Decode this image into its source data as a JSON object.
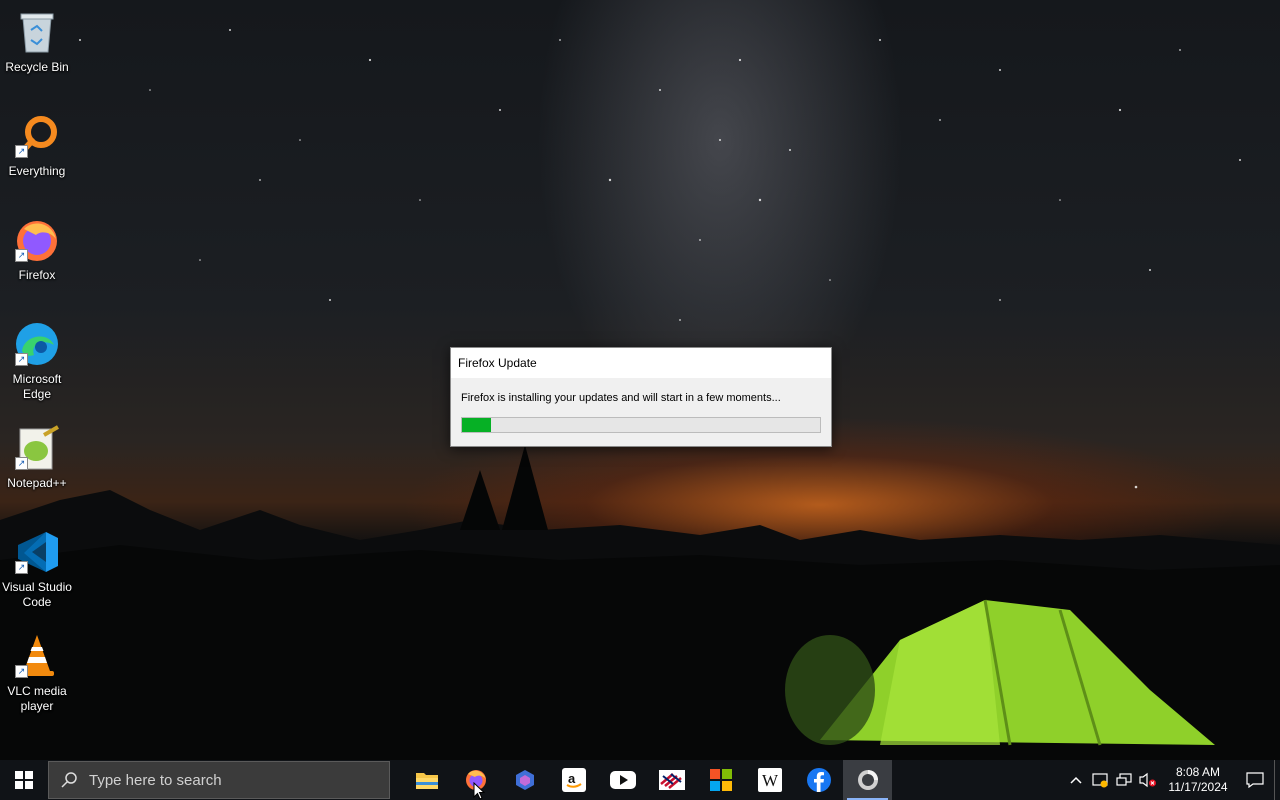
{
  "desktop": {
    "icons": [
      {
        "label": "Recycle Bin",
        "icon": "recycle-bin-icon"
      },
      {
        "label": "Everything",
        "icon": "everything-search-icon"
      },
      {
        "label": "Firefox",
        "icon": "firefox-icon"
      },
      {
        "label": "Microsoft Edge",
        "icon": "edge-icon"
      },
      {
        "label": "Notepad++",
        "icon": "notepadpp-icon"
      },
      {
        "label": "Visual Studio Code",
        "icon": "vscode-icon"
      },
      {
        "label": "VLC media player",
        "icon": "vlc-icon"
      }
    ]
  },
  "dialog": {
    "title": "Firefox Update",
    "message": "Firefox is installing your updates and will start in a few moments...",
    "progress_fraction": 0.08,
    "progress_color": "#06b025"
  },
  "taskbar": {
    "search_placeholder": "Type here to search",
    "apps": [
      {
        "name": "File Explorer",
        "icon": "file-explorer-icon"
      },
      {
        "name": "Firefox",
        "icon": "firefox-icon"
      },
      {
        "name": "Copilot",
        "icon": "copilot-icon"
      },
      {
        "name": "Amazon",
        "icon": "amazon-icon"
      },
      {
        "name": "YouTube",
        "icon": "youtube-icon"
      },
      {
        "name": "Bank of America",
        "icon": "bank-of-america-icon"
      },
      {
        "name": "Microsoft Store",
        "icon": "microsoft-store-icon"
      },
      {
        "name": "Wikipedia",
        "icon": "wikipedia-icon"
      },
      {
        "name": "Facebook",
        "icon": "facebook-icon"
      },
      {
        "name": "Firefox Update",
        "icon": "firefox-update-icon",
        "active": true
      }
    ],
    "clock": {
      "time": "8:08 AM",
      "date": "11/17/2024"
    }
  }
}
